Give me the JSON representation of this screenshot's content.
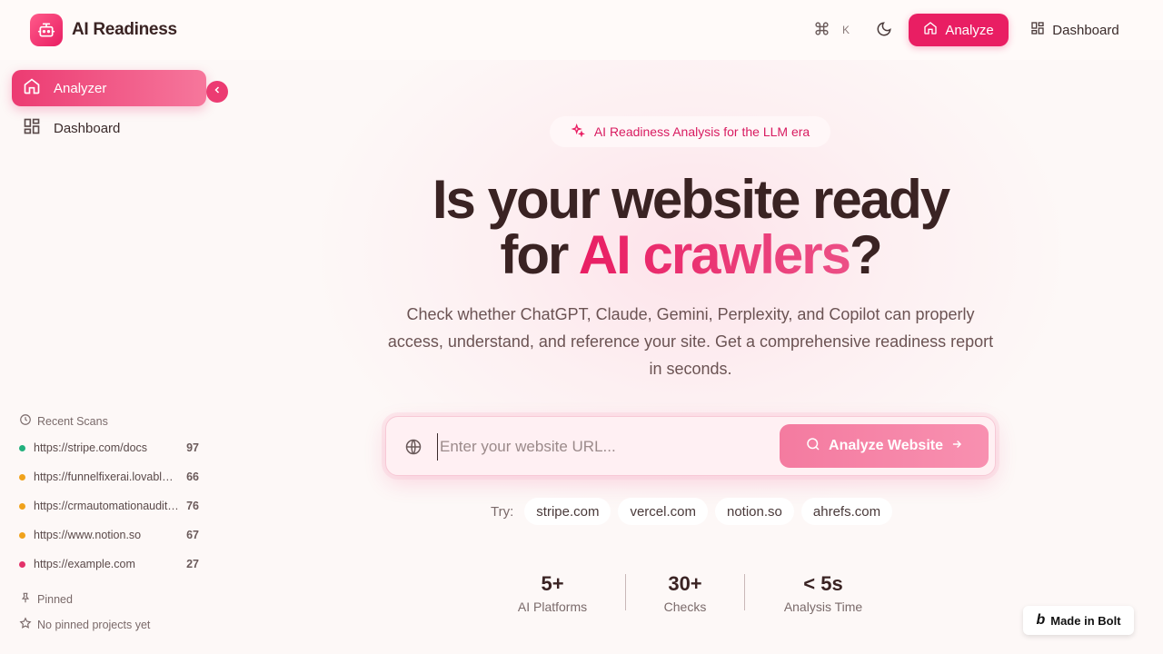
{
  "header": {
    "brand": "AI Readiness",
    "shortcut_key": "K",
    "analyze_label": "Analyze",
    "dashboard_label": "Dashboard"
  },
  "sidebar": {
    "items": [
      {
        "label": "Analyzer",
        "active": true
      },
      {
        "label": "Dashboard",
        "active": false
      }
    ],
    "recent_title": "Recent Scans",
    "recent": [
      {
        "url": "https://stripe.com/docs",
        "score": "97",
        "color": "#22b07d"
      },
      {
        "url": "https://funnelfixerai.lovable.app",
        "score": "66",
        "color": "#f0a21b"
      },
      {
        "url": "https://crmautomationaudit.com",
        "score": "76",
        "color": "#f0a21b"
      },
      {
        "url": "https://www.notion.so",
        "score": "67",
        "color": "#f0a21b"
      },
      {
        "url": "https://example.com",
        "score": "27",
        "color": "#e3326a"
      }
    ],
    "pinned_title": "Pinned",
    "pinned_empty": "No pinned projects yet"
  },
  "main": {
    "badge": "AI Readiness Analysis for the LLM era",
    "hero_line1": "Is your website ready",
    "hero_line2_prefix": "for ",
    "hero_line2_highlight": "AI crawlers",
    "hero_line2_suffix": "?",
    "subtitle": "Check whether ChatGPT, Claude, Gemini, Perplexity, and Copilot can properly access, understand, and reference your site. Get a comprehensive readiness report in seconds.",
    "search": {
      "placeholder": "Enter your website URL...",
      "button_label": "Analyze Website"
    },
    "try_label": "Try:",
    "try_chips": [
      "stripe.com",
      "vercel.com",
      "notion.so",
      "ahrefs.com"
    ],
    "stats": [
      {
        "value": "5+",
        "label": "AI Platforms"
      },
      {
        "value": "30+",
        "label": "Checks"
      },
      {
        "value": "< 5s",
        "label": "Analysis Time"
      }
    ]
  },
  "footer": {
    "bolt_label": "Made in Bolt"
  },
  "colors": {
    "accent": "#e91e63",
    "text": "#3a2323"
  }
}
